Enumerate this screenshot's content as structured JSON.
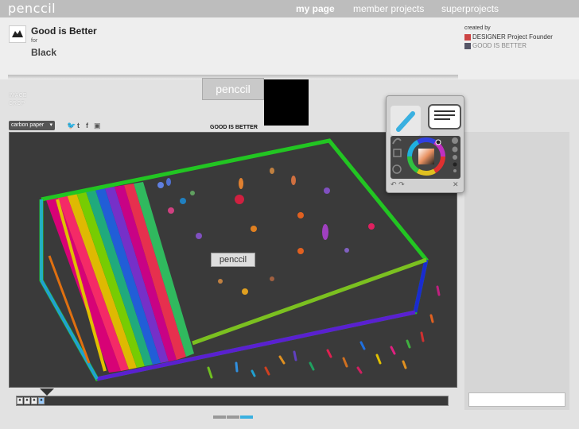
{
  "nav": {
    "logo": "penccil",
    "items": [
      {
        "label": "my page",
        "active": true
      },
      {
        "label": "member projects",
        "active": false
      },
      {
        "label": "superprojects",
        "active": false
      }
    ]
  },
  "project": {
    "title": "Good is Better",
    "for_label": "for",
    "subtitle": "Black"
  },
  "credits": {
    "created_by": "created by",
    "creator": "DESIGNER Project Founder",
    "project_name": "GOOD IS BETTER"
  },
  "thumbnail": {
    "logo_text": "penccil"
  },
  "side_menu": {
    "image": "IMAGE",
    "crop": "CROP"
  },
  "toolbar": {
    "dropdown_value": "carbon paper",
    "canvas_title": "GOOD IS BETTER"
  },
  "canvas": {
    "logo_text": "penccil"
  },
  "colors": {
    "accent": "#3ab0e0",
    "canvas_bg": "#3a3a3a",
    "page_bg": "#e2e2e2"
  }
}
